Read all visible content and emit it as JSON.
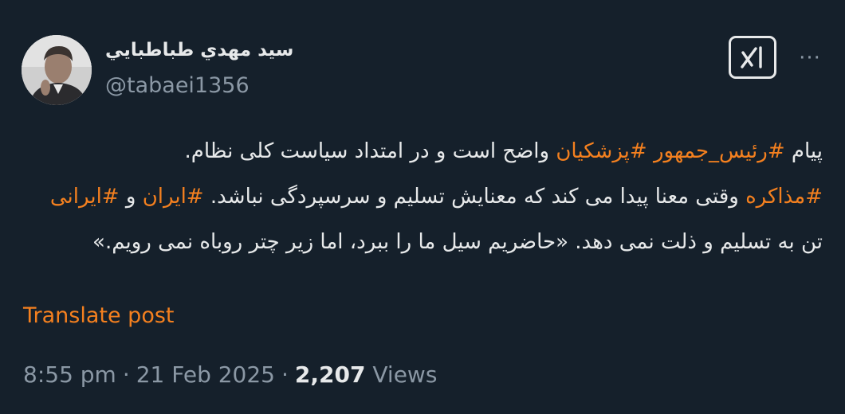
{
  "author": {
    "name": "سيد مهدي طباطبايي",
    "handle": "@tabaei1356"
  },
  "icons": {
    "grok": "grok-icon",
    "more": "more-horizontal-icon"
  },
  "more_label": "···",
  "post": {
    "segments": [
      {
        "type": "text",
        "text": "پیام "
      },
      {
        "type": "hashtag",
        "text": "#رئیس_جمهور"
      },
      {
        "type": "text",
        "text": " "
      },
      {
        "type": "hashtag",
        "text": "#پزشکیان"
      },
      {
        "type": "text",
        "text": " واضح است و در امتداد سیاست کلی نظام."
      },
      {
        "type": "break"
      },
      {
        "type": "hashtag",
        "text": "#مذاکره"
      },
      {
        "type": "text",
        "text": " وقتی معنا پیدا می کند که معنایش تسلیم و سرسپردگی نباشد.  "
      },
      {
        "type": "hashtag",
        "text": "#ایران"
      },
      {
        "type": "text",
        "text": " و "
      },
      {
        "type": "hashtag",
        "text": "#ایرانی"
      },
      {
        "type": "text",
        "text": " تن به تسلیم و ذلت نمی دهد. «حاضریم سیل ما را ببرد، اما زیر چتر روباه نمی رویم.»"
      }
    ]
  },
  "translate_label": "Translate post",
  "meta": {
    "time": "8:55 pm",
    "separator": "·",
    "date": "21 Feb 2025",
    "views_count": "2,207",
    "views_label": "Views"
  },
  "colors": {
    "background": "#15202b",
    "accent": "#f4801f",
    "text": "#e7e9ea",
    "secondary": "#8b98a5"
  }
}
